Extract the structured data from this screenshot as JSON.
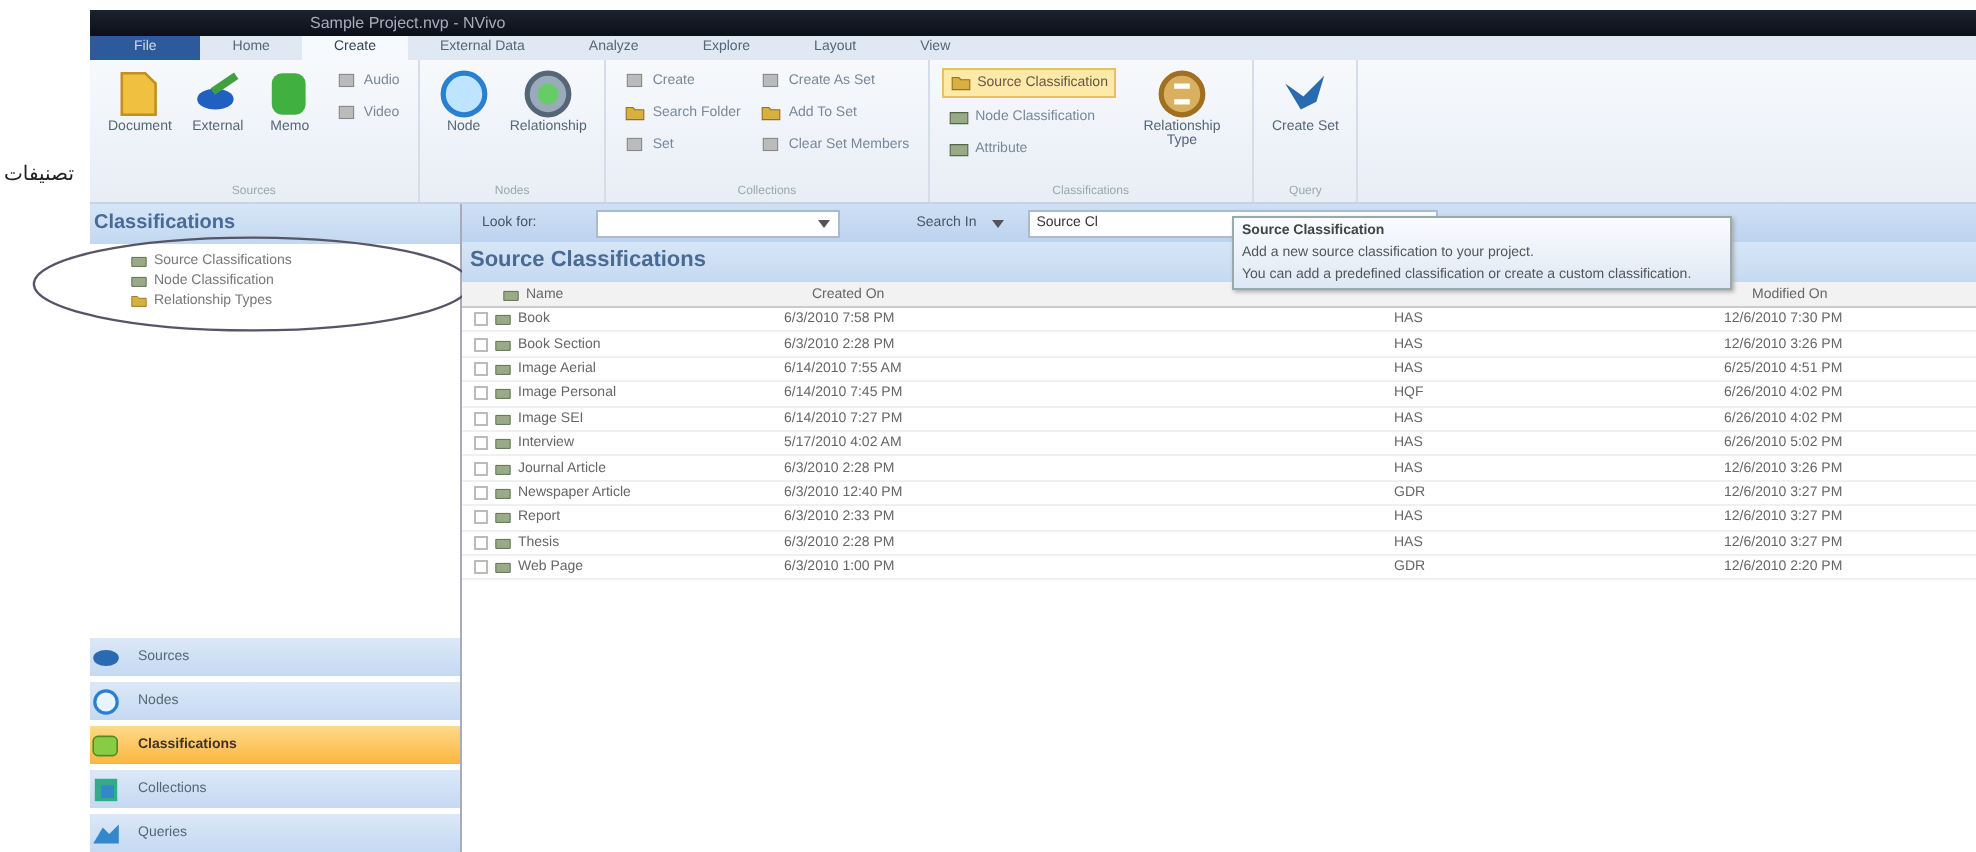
{
  "annotation": {
    "label": "تصنيفات"
  },
  "window": {
    "title": "Sample Project.nvp - NVivo"
  },
  "ribbon_tabs": [
    {
      "label": "File",
      "kind": "file",
      "selected": false
    },
    {
      "label": "Home",
      "kind": "tab",
      "selected": false
    },
    {
      "label": "Create",
      "kind": "tab",
      "selected": true
    },
    {
      "label": "External Data",
      "kind": "tab",
      "selected": false
    },
    {
      "label": "Analyze",
      "kind": "tab",
      "selected": false
    },
    {
      "label": "Explore",
      "kind": "tab",
      "selected": false
    },
    {
      "label": "Layout",
      "kind": "tab",
      "selected": false
    },
    {
      "label": "View",
      "kind": "tab",
      "selected": false
    }
  ],
  "ribbon_groups": [
    {
      "label": "Sources",
      "items": [
        {
          "kind": "large",
          "label": "Document"
        },
        {
          "kind": "large",
          "label": "External"
        },
        {
          "kind": "large",
          "label": "Memo"
        },
        {
          "kind": "small",
          "label": "Audio",
          "next": "Video"
        }
      ]
    },
    {
      "label": "Nodes",
      "items": [
        {
          "kind": "large",
          "label": "Node"
        },
        {
          "kind": "large",
          "label": "Relationship"
        }
      ]
    },
    {
      "label": "Collections",
      "items": [
        {
          "kind": "small3",
          "labels": [
            "Create",
            "Search Folder",
            "Set"
          ]
        },
        {
          "kind": "small3",
          "labels": [
            "Create As Set",
            "Add To Set",
            "Clear Set Members"
          ]
        }
      ]
    },
    {
      "label": "Classifications",
      "items": [
        {
          "kind": "classify",
          "buttons": [
            {
              "label": "Source Classification",
              "selected": true
            },
            {
              "label": "Node Classification",
              "selected": false
            },
            {
              "label": "Attribute",
              "selected": false
            }
          ]
        },
        {
          "kind": "large",
          "label": "Relationship Type"
        }
      ]
    },
    {
      "label": "Query",
      "items": [
        {
          "kind": "large",
          "label": "Create Set"
        }
      ]
    }
  ],
  "navigation": {
    "title": "Classifications",
    "tree": [
      {
        "label": "Source Classifications",
        "selected": false
      },
      {
        "label": "Node Classification",
        "selected": false
      },
      {
        "label": "Relationship Types",
        "selected": false
      }
    ],
    "buttons": [
      {
        "label": "Sources",
        "selected": false
      },
      {
        "label": "Nodes",
        "selected": false
      },
      {
        "label": "Classifications",
        "selected": true
      },
      {
        "label": "Collections",
        "selected": false
      },
      {
        "label": "Queries",
        "selected": false
      }
    ]
  },
  "find_bar": {
    "look_for_label": "Look for:",
    "search_in_label": "Search In",
    "search_in_value": "Source Cl"
  },
  "tooltip": {
    "title": "Source Classification",
    "lines": [
      "Add a new source classification to your project.",
      "You can add a predefined classification or create a custom classification."
    ]
  },
  "list": {
    "title": "Source Classifications",
    "columns": [
      "Name",
      "Created On",
      "",
      "Modified On"
    ],
    "rows": [
      [
        "Book",
        "6/3/2010 7:58 PM",
        "HAS",
        "12/6/2010 7:30 PM"
      ],
      [
        "Book Section",
        "6/3/2010 2:28 PM",
        "HAS",
        "12/6/2010 3:26 PM"
      ],
      [
        "Image Aerial",
        "6/14/2010 7:55 AM",
        "HAS",
        "6/25/2010 4:51 PM"
      ],
      [
        "Image Personal",
        "6/14/2010 7:45 PM",
        "HQF",
        "6/26/2010 4:02 PM"
      ],
      [
        "Image SEI",
        "6/14/2010 7:27 PM",
        "HAS",
        "6/26/2010 4:02 PM"
      ],
      [
        "Interview",
        "5/17/2010 4:02 AM",
        "HAS",
        "6/26/2010 5:02 PM"
      ],
      [
        "Journal Article",
        "6/3/2010 2:28 PM",
        "HAS",
        "12/6/2010 3:26 PM"
      ],
      [
        "Newspaper Article",
        "6/3/2010 12:40 PM",
        "GDR",
        "12/6/2010 3:27 PM"
      ],
      [
        "Report",
        "6/3/2010 2:33 PM",
        "HAS",
        "12/6/2010 3:27 PM"
      ],
      [
        "Thesis",
        "6/3/2010 2:28 PM",
        "HAS",
        "12/6/2010 3:27 PM"
      ],
      [
        "Web Page",
        "6/3/2010 1:00 PM",
        "GDR",
        "12/6/2010 2:20 PM"
      ]
    ]
  }
}
